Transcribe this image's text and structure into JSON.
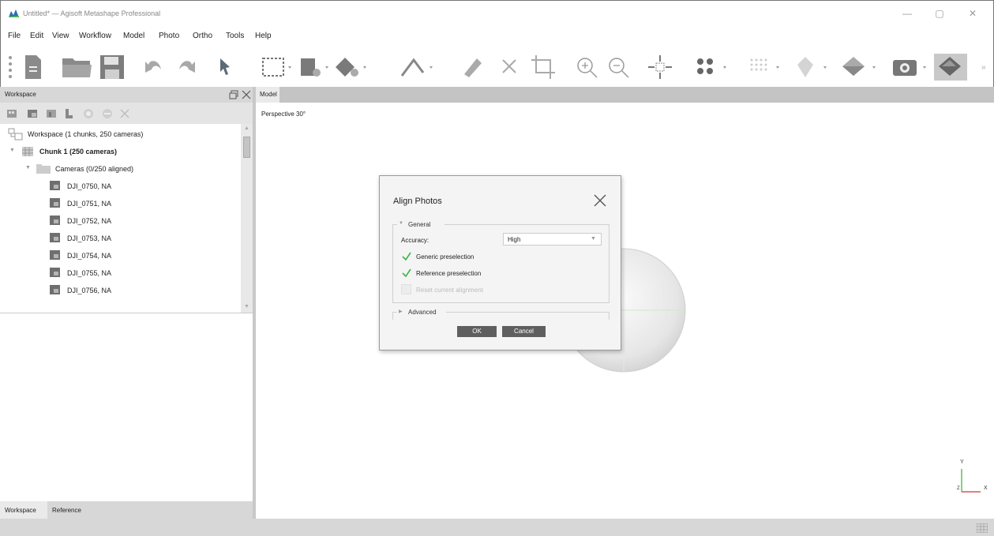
{
  "window": {
    "title": "Untitled* — Agisoft Metashape Professional",
    "controls": [
      "minimize-icon",
      "restore-icon",
      "close-icon"
    ]
  },
  "menu": [
    "File",
    "Edit",
    "View",
    "Workflow",
    "Model",
    "Photo",
    "Ortho",
    "Tools",
    "Help"
  ],
  "toolbar_icons": [
    "new-document-icon",
    "open-folder-icon",
    "save-icon",
    "undo-icon",
    "redo-icon",
    "pointer-icon",
    "rectangle-selection-icon",
    "navigation-icon",
    "move-object-icon",
    "measure-icon",
    "ruler-icon",
    "delete-icon",
    "crop-icon",
    "zoom-in-icon",
    "zoom-out-icon",
    "move-view-icon",
    "point-cloud-icon",
    "dense-cloud-icon",
    "tiled-model-icon",
    "mesh-icon",
    "camera-icon",
    "texture-icon"
  ],
  "workspace": {
    "panel_title": "Workspace",
    "root": "Workspace (1 chunks, 250 cameras)",
    "chunk": "Chunk 1 (250 cameras)",
    "cameras_folder": "Cameras (0/250 aligned)",
    "cameras": [
      "DJI_0750, NA",
      "DJI_0751, NA",
      "DJI_0752, NA",
      "DJI_0753, NA",
      "DJI_0754, NA",
      "DJI_0755, NA",
      "DJI_0756, NA"
    ],
    "tabs": [
      "Workspace",
      "Reference"
    ]
  },
  "model": {
    "tab": "Model",
    "projection": "Perspective 30°",
    "axis_y": "Y",
    "axis_x": "X",
    "axis_z": "Z"
  },
  "dialog": {
    "title": "Align Photos",
    "general_label": "General",
    "accuracy_label": "Accuracy:",
    "accuracy_value": "High",
    "generic_preselection": "Generic preselection",
    "generic_checked": true,
    "reference_preselection": "Reference preselection",
    "reference_checked": true,
    "reset_alignment": "Reset current alignment",
    "reset_checked": false,
    "advanced_label": "Advanced",
    "ok": "OK",
    "cancel": "Cancel"
  },
  "colors": {
    "check": "#3db34a",
    "button": "#5f5f5f"
  }
}
